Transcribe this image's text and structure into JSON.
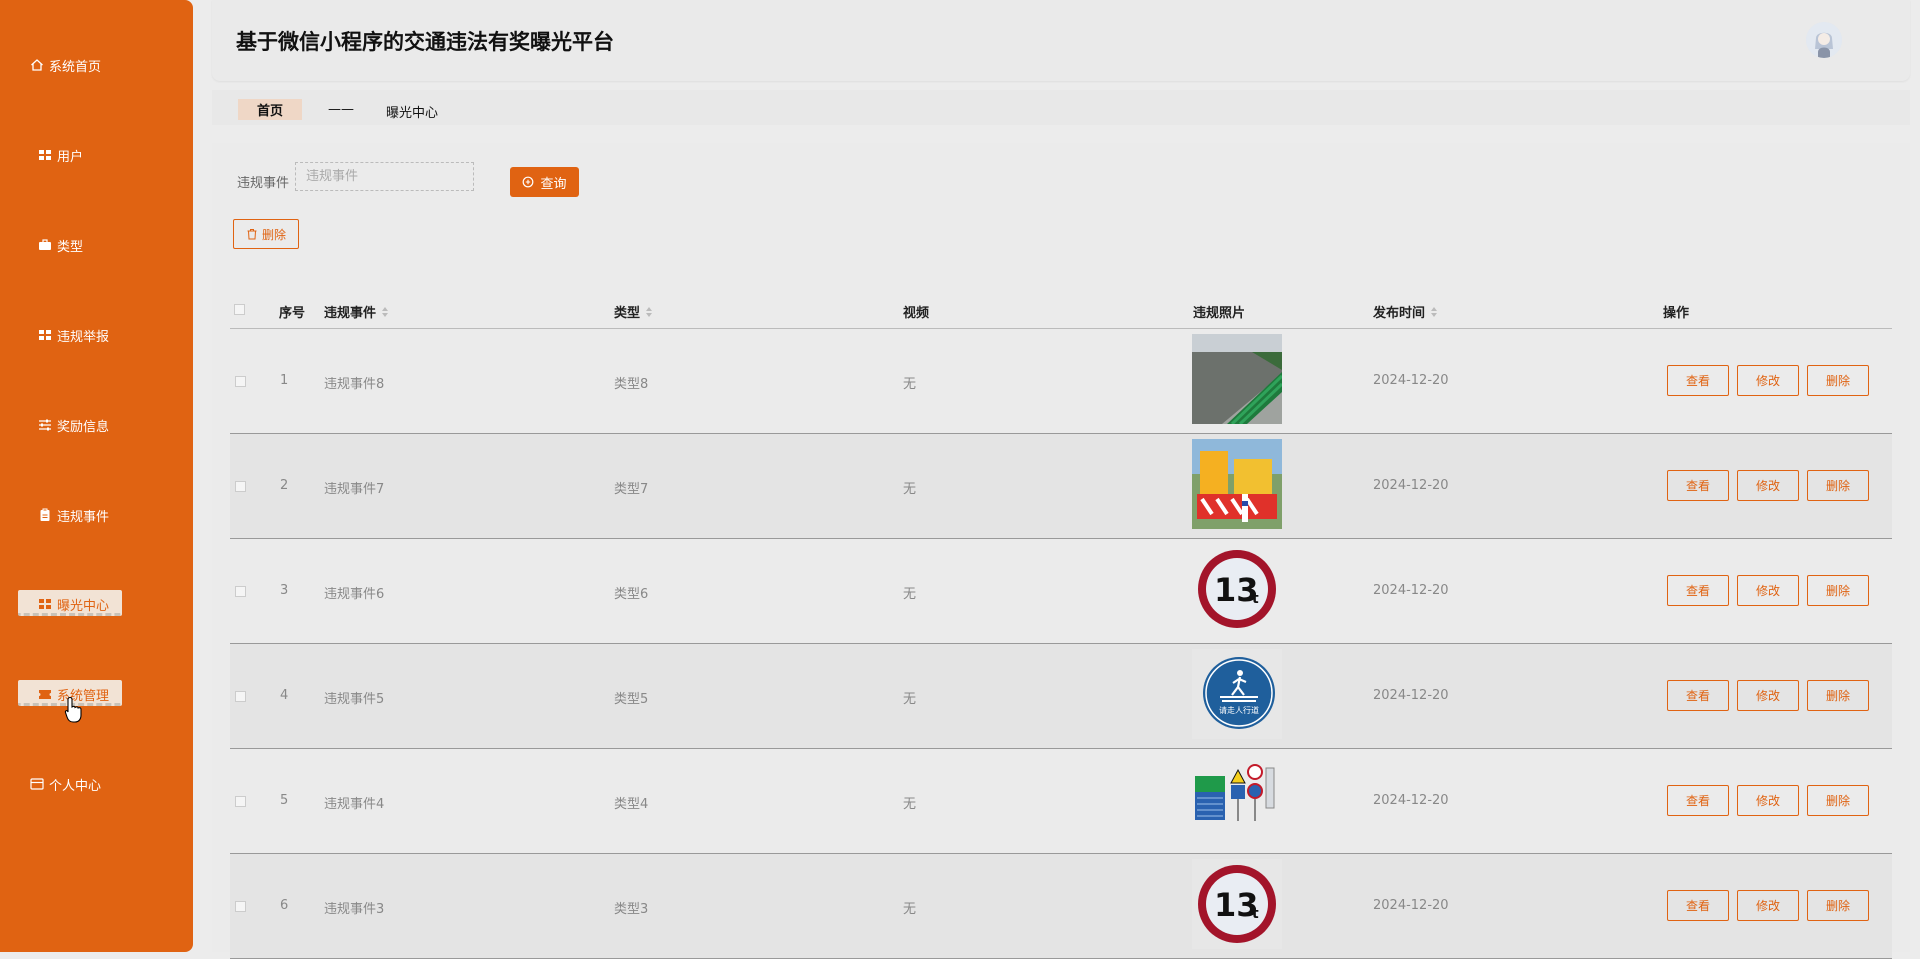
{
  "app": {
    "title": "基于微信小程序的交通违法有奖曝光平台"
  },
  "sidebar": {
    "items": [
      {
        "label": "系统首页",
        "icon": "home-icon"
      },
      {
        "label": "用户",
        "icon": "grid-icon"
      },
      {
        "label": "类型",
        "icon": "briefcase-icon"
      },
      {
        "label": "违规举报",
        "icon": "grid-icon"
      },
      {
        "label": "奖励信息",
        "icon": "sliders-icon"
      },
      {
        "label": "违规事件",
        "icon": "clipboard-icon"
      },
      {
        "label": "曝光中心",
        "icon": "grid-icon",
        "active": true
      },
      {
        "label": "系统管理",
        "icon": "ticket-icon",
        "active": true
      },
      {
        "label": "个人中心",
        "icon": "card-icon"
      }
    ]
  },
  "breadcrumb": {
    "home": "首页",
    "separator": "——",
    "current": "曝光中心"
  },
  "search": {
    "label": "违规事件",
    "placeholder": "违规事件",
    "button": "查询"
  },
  "toolbar": {
    "delete_label": "删除"
  },
  "table": {
    "headers": {
      "index": "序号",
      "event": "违规事件",
      "type": "类型",
      "video": "视频",
      "photo": "违规照片",
      "date": "发布时间",
      "actions": "操作"
    },
    "actions": {
      "view": "查看",
      "edit": "修改",
      "delete": "删除"
    },
    "rows": [
      {
        "index": "1",
        "event": "违规事件8",
        "type": "类型8",
        "video": "无",
        "photo": "guardrail-photo",
        "date": "2024-12-20"
      },
      {
        "index": "2",
        "event": "违规事件7",
        "type": "类型7",
        "video": "无",
        "photo": "road-barrier-photo",
        "date": "2024-12-20"
      },
      {
        "index": "3",
        "event": "违规事件6",
        "type": "类型6",
        "video": "无",
        "photo": "weight-limit-13t-sign",
        "date": "2024-12-20"
      },
      {
        "index": "4",
        "event": "违规事件5",
        "type": "类型5",
        "video": "无",
        "photo": "crosswalk-sign",
        "photo_text": "请走人行道",
        "date": "2024-12-20"
      },
      {
        "index": "5",
        "event": "违规事件4",
        "type": "类型4",
        "video": "无",
        "photo": "traffic-signs-set",
        "date": "2024-12-20"
      },
      {
        "index": "6",
        "event": "违规事件3",
        "type": "类型3",
        "video": "无",
        "photo": "weight-limit-13t-sign",
        "date": "2024-12-20"
      }
    ]
  },
  "colors": {
    "accent": "#e06312",
    "sidebar": "#e06312",
    "background": "#ececec"
  }
}
